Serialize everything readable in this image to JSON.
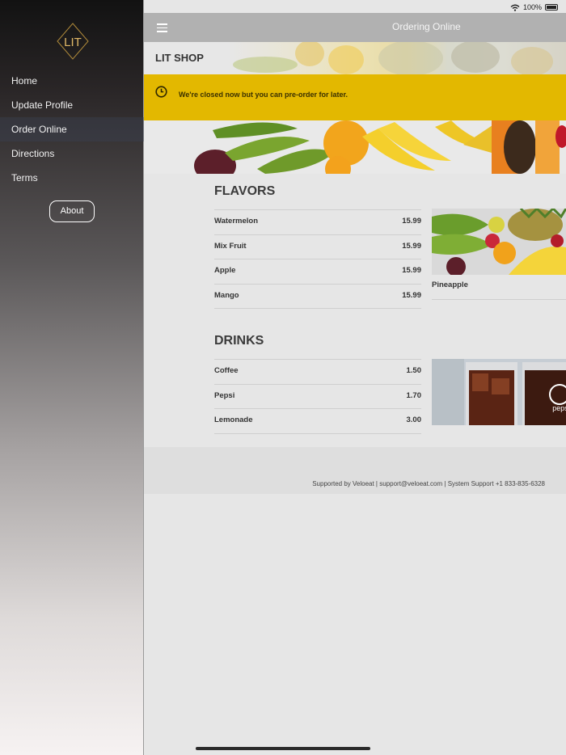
{
  "status": {
    "battery": "100%"
  },
  "sidebar": {
    "logo": "LIT",
    "items": [
      {
        "label": "Home"
      },
      {
        "label": "Update Profile"
      },
      {
        "label": "Order Online"
      },
      {
        "label": "Directions"
      },
      {
        "label": "Terms"
      }
    ],
    "about_label": "About"
  },
  "header": {
    "title": "Ordering Online"
  },
  "shop": {
    "name": "LIT SHOP"
  },
  "notice": {
    "text": "We're closed now but you can pre-order for later."
  },
  "menu": {
    "flavors": {
      "title": "FLAVORS",
      "items": [
        {
          "name": "Watermelon",
          "price": "15.99"
        },
        {
          "name": "Mix Fruit",
          "price": "15.99"
        },
        {
          "name": "Apple",
          "price": "15.99"
        },
        {
          "name": "Mango",
          "price": "15.99"
        }
      ],
      "featured": "Pineapple"
    },
    "drinks": {
      "title": "DRINKS",
      "items": [
        {
          "name": "Coffee",
          "price": "1.50"
        },
        {
          "name": "Pepsi",
          "price": "1.70"
        },
        {
          "name": "Lemonade",
          "price": "3.00"
        }
      ],
      "brand_mark": "pepsi"
    }
  },
  "footer": {
    "text": "Supported by Veloeat | support@veloeat.com | System Support +1 833-835-6328"
  },
  "colors": {
    "notice": "#e3b800",
    "header": "#b1b1b1"
  }
}
